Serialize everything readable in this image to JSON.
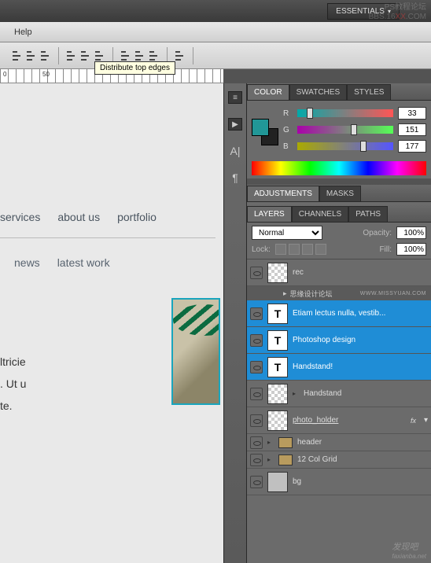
{
  "workspace": {
    "label": "ESSENTIALS"
  },
  "watermarks": {
    "top_line1": "PS教程论坛",
    "top_line2a": "BBS.16",
    "top_xx": "XX",
    "top_line2b": ".COM",
    "bottom": "发现吧",
    "bottom_sub": "faxianba.net"
  },
  "menu": {
    "help": "Help"
  },
  "tooltip": "Distribute top edges",
  "ruler": {
    "l0": "0",
    "l50": "50"
  },
  "canvas": {
    "nav": [
      "services",
      "about us",
      "portfolio"
    ],
    "sub": [
      "news",
      "latest work"
    ],
    "body1": "ltricie",
    "body2": ". Ut u",
    "body3": "te."
  },
  "panels": {
    "color_tab": "COLOR",
    "swatches_tab": "SWATCHES",
    "styles_tab": "STYLES",
    "adjustments_tab": "ADJUSTMENTS",
    "masks_tab": "MASKS",
    "layers_tab": "LAYERS",
    "channels_tab": "CHANNELS",
    "paths_tab": "PATHS"
  },
  "color": {
    "r_label": "R",
    "g_label": "G",
    "b_label": "B",
    "r": "33",
    "g": "151",
    "b": "177"
  },
  "layers_panel": {
    "blend": "Normal",
    "opacity_label": "Opacity:",
    "opacity": "100%",
    "lock_label": "Lock:",
    "fill_label": "Fill:",
    "fill": "100%"
  },
  "layers": {
    "rec": "rec",
    "divider": "思缘设计论坛",
    "divider_sig": "WWW.MISSYUAN.COM",
    "t1": "Etiam lectus nulla, vestib...",
    "t2": "Photoshop design",
    "t3": "Handstand!",
    "handstand": "Handstand",
    "photo_holder": "photo_holder",
    "header": "header",
    "grid": "12 Col Grid",
    "bg": "bg",
    "fx": "fx",
    "arrow": "▸",
    "arrow_down": "▾",
    "t_glyph": "T"
  }
}
